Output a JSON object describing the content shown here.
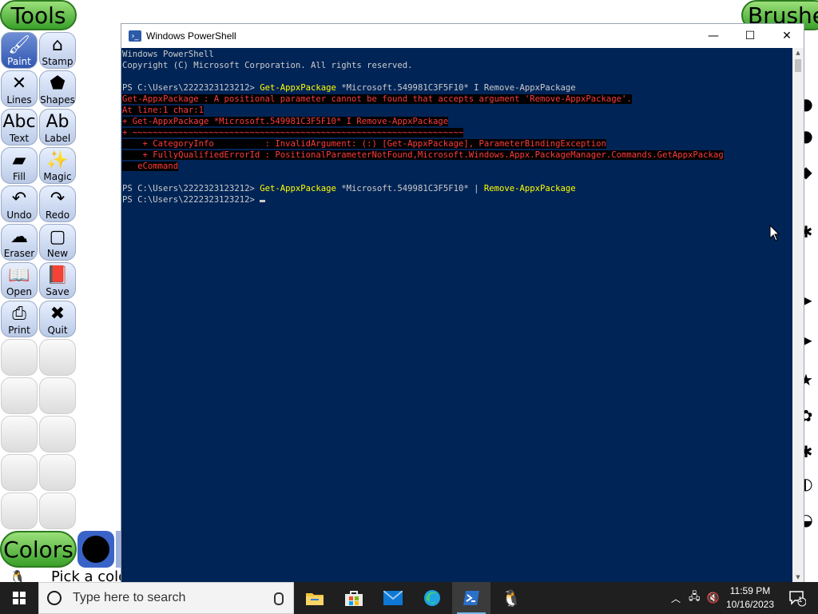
{
  "tuxpaint": {
    "tools_title": "Tools",
    "brushes_title": "Brushes",
    "colors_title": "Colors",
    "status_text": "Pick a colo",
    "tools": [
      {
        "label": "Paint",
        "icon": "paintbrush-icon",
        "glyph": "🖌"
      },
      {
        "label": "Stamp",
        "icon": "stamp-icon",
        "glyph": "⌂"
      },
      {
        "label": "Lines",
        "icon": "lines-icon",
        "glyph": "✕"
      },
      {
        "label": "Shapes",
        "icon": "shapes-icon",
        "glyph": "⬟"
      },
      {
        "label": "Text",
        "icon": "text-icon",
        "glyph": "Abc"
      },
      {
        "label": "Label",
        "icon": "label-icon",
        "glyph": "Ab"
      },
      {
        "label": "Fill",
        "icon": "fill-bucket-icon",
        "glyph": "▰"
      },
      {
        "label": "Magic",
        "icon": "magic-wand-icon",
        "glyph": "✨"
      },
      {
        "label": "Undo",
        "icon": "undo-icon",
        "glyph": "↶"
      },
      {
        "label": "Redo",
        "icon": "redo-icon",
        "glyph": "↷"
      },
      {
        "label": "Eraser",
        "icon": "eraser-icon",
        "glyph": "☁"
      },
      {
        "label": "New",
        "icon": "new-page-icon",
        "glyph": "▢"
      },
      {
        "label": "Open",
        "icon": "open-book-icon",
        "glyph": "📖"
      },
      {
        "label": "Save",
        "icon": "save-book-icon",
        "glyph": "📕"
      },
      {
        "label": "Print",
        "icon": "printer-icon",
        "glyph": "⎙"
      },
      {
        "label": "Quit",
        "icon": "quit-icon",
        "glyph": "✖"
      }
    ],
    "selected_tool": "Paint"
  },
  "powershell": {
    "title": "Windows PowerShell",
    "controls": {
      "minimize": "—",
      "maximize": "☐",
      "close": "✕"
    },
    "header_line1": "Windows PowerShell",
    "header_line2": "Copyright (C) Microsoft Corporation. All rights reserved.",
    "prompt": "PS C:\\Users\\2222323123212> ",
    "cmd1_part1": "Get-AppxPackage",
    "cmd1_part2": " *Microsoft.549981C3F5F10* I Remove-AppxPackage",
    "err_lines": [
      "Get-AppxPackage : A positional parameter cannot be found that accepts argument 'Remove-AppxPackage'.",
      "At line:1 char:1",
      "+ Get-AppxPackage *Microsoft.549981C3F5F10* I Remove-AppxPackage",
      "+ ~~~~~~~~~~~~~~~~~~~~~~~~~~~~~~~~~~~~~~~~~~~~~~~~~~~~~~~~~~~~~~~~~",
      "    + CategoryInfo          : InvalidArgument: (:) [Get-AppxPackage], ParameterBindingException",
      "    + FullyQualifiedErrorId : PositionalParameterNotFound,Microsoft.Windows.Appx.PackageManager.Commands.GetAppxPackag",
      "   eCommand"
    ],
    "cmd2_part1": "Get-AppxPackage",
    "cmd2_part2": " *Microsoft.549981C3F5F10* | ",
    "cmd2_part3": "Remove-AppxPackage",
    "colors": {
      "console_bg": "#012456",
      "error_text": "#ff3b3b",
      "command_text": "#ffff00"
    }
  },
  "taskbar": {
    "search_placeholder": "Type here to search",
    "apps": [
      "file-explorer",
      "microsoft-store",
      "mail",
      "edge",
      "powershell",
      "tux-paint"
    ],
    "time": "11:59 PM",
    "date": "10/16/2023",
    "notification_count": "1"
  }
}
